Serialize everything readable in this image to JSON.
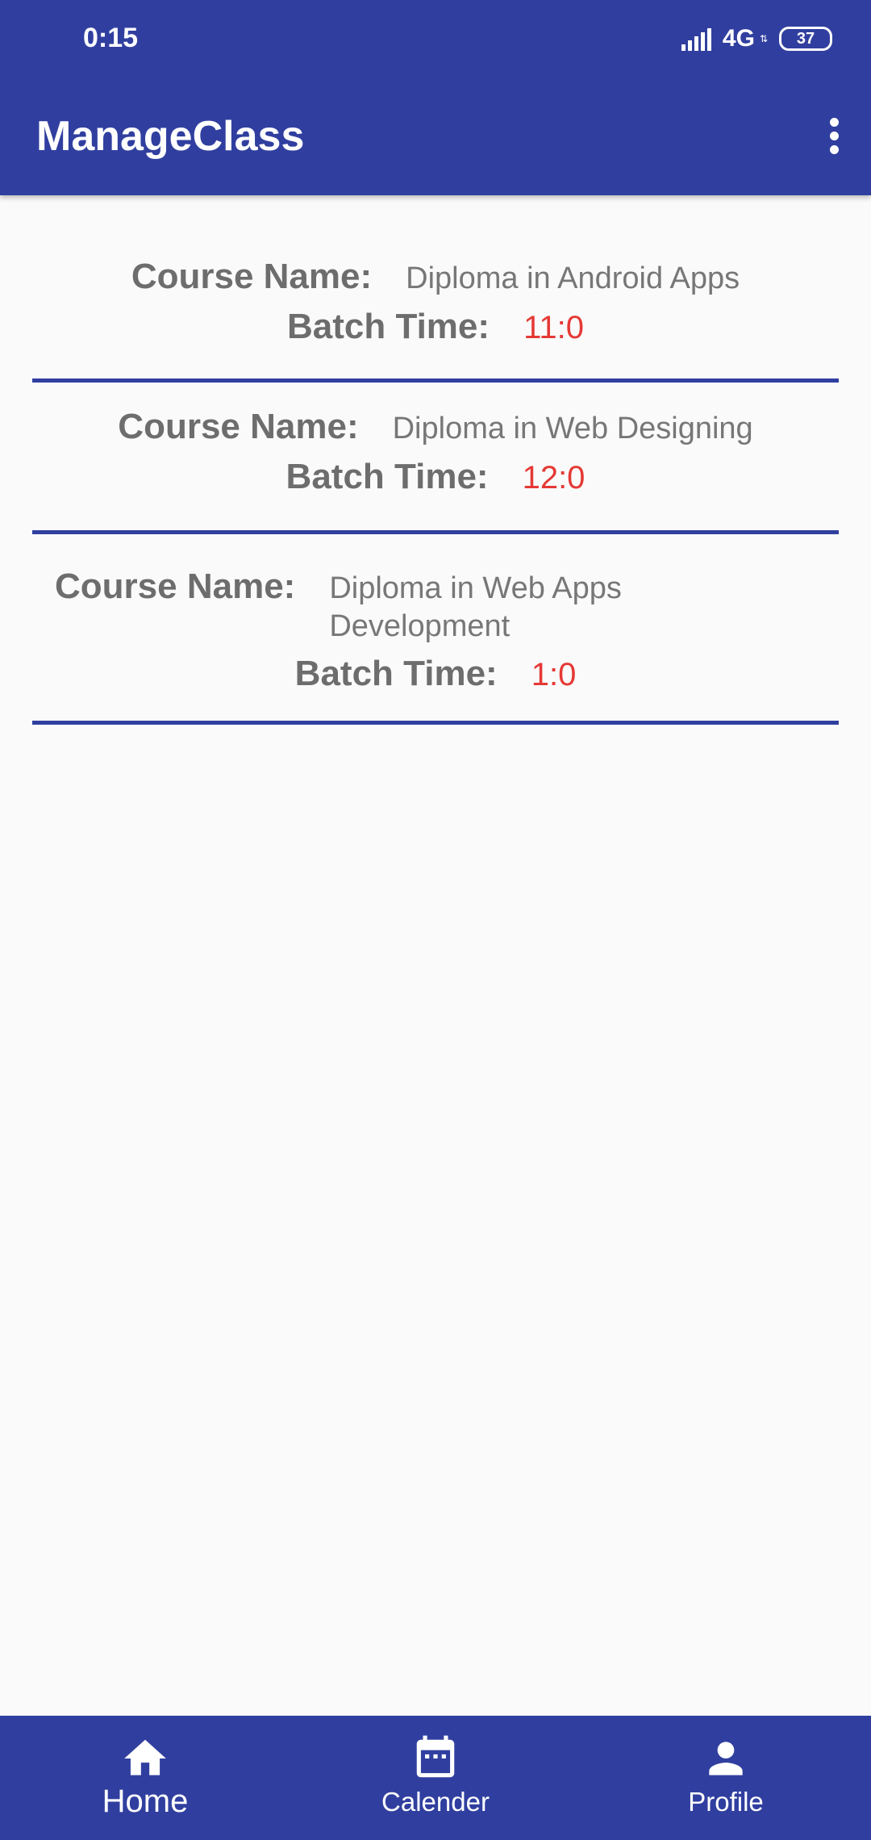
{
  "status_bar": {
    "time": "0:15",
    "network": "4G",
    "battery": "37"
  },
  "app_bar": {
    "title": "ManageClass"
  },
  "labels": {
    "course_name": "Course Name:",
    "batch_time": "Batch Time:"
  },
  "courses": [
    {
      "name": "Diploma in Android Apps",
      "batch_time": "11:0"
    },
    {
      "name": "Diploma in Web Designing",
      "batch_time": "12:0"
    },
    {
      "name": "Diploma in Web Apps Development",
      "batch_time": "1:0"
    }
  ],
  "bottom_nav": {
    "items": [
      {
        "label": "Home",
        "icon": "home-icon",
        "active": true
      },
      {
        "label": "Calender",
        "icon": "calendar-icon",
        "active": false
      },
      {
        "label": "Profile",
        "icon": "person-icon",
        "active": false
      }
    ]
  },
  "colors": {
    "primary": "#303f9f",
    "batch_time_text": "#e53935",
    "label_text": "#6d6d6d",
    "background": "#fafafa"
  }
}
